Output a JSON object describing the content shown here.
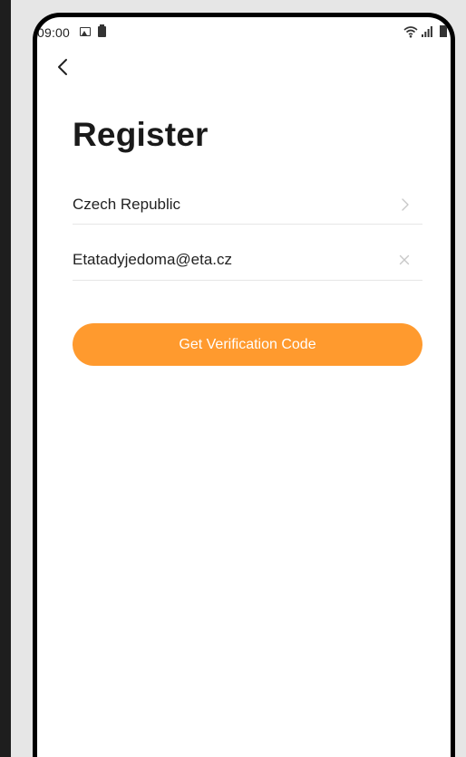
{
  "status_bar": {
    "time": "09:00",
    "icons": [
      "gallery-icon",
      "storage-icon",
      "wifi-icon",
      "signal-icon",
      "battery-icon"
    ]
  },
  "nav": {
    "back_icon": "chevron-left-icon"
  },
  "page": {
    "title": "Register"
  },
  "form": {
    "country": {
      "value": "Czech Republic",
      "icon": "chevron-right-icon"
    },
    "email": {
      "value": "Etatadyjedoma@eta.cz",
      "clear_icon": "close-icon"
    },
    "submit_label": "Get Verification Code"
  },
  "colors": {
    "accent": "#ff9a2e",
    "background": "#ffffff",
    "divider": "#e6e6e6",
    "text": "#222222"
  }
}
